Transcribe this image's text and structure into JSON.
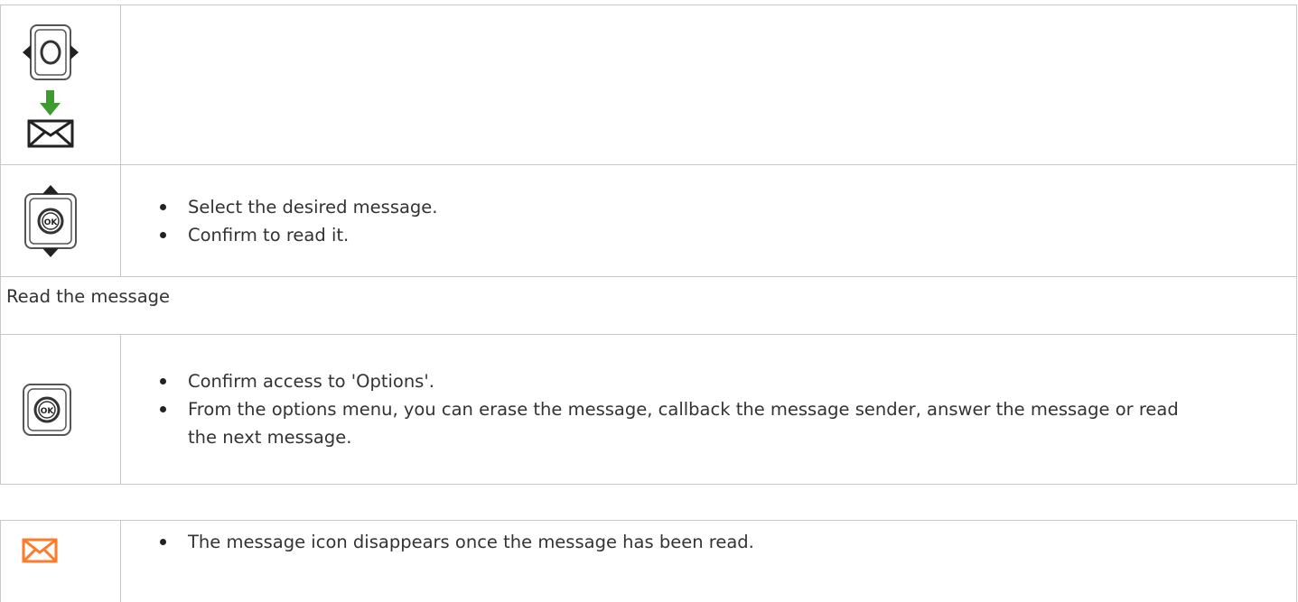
{
  "table_main": {
    "row1": {
      "icons": [
        "left-right-navigator-icon",
        "download-message-icon"
      ]
    },
    "row2": {
      "icon": "up-down-ok-navigator-icon",
      "bullets": [
        "Select the desired message.",
        "Confirm to read it."
      ]
    },
    "row3": {
      "text": "Read the message"
    },
    "row4": {
      "icon": "ok-button-icon",
      "bullets": [
        "Confirm access to 'Options'.",
        "From the options menu, you can erase the message, callback the message sender, answer the message or read the next message."
      ]
    }
  },
  "table_note": {
    "row1": {
      "icon": "message-envelope-icon",
      "bullets": [
        "The message icon disappears once the message has been read."
      ]
    }
  },
  "colors": {
    "border": "#c8c8c8",
    "text": "#333333",
    "envelope_orange": "#ff7a2b",
    "arrow_green": "#3f9b2f"
  }
}
